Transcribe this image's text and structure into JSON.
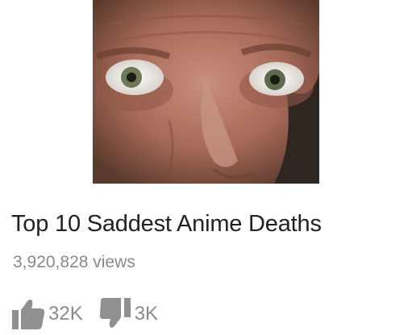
{
  "video": {
    "title": "Top 10 Saddest Anime Deaths",
    "views": "3,920,828 views"
  },
  "actions": {
    "like_count": "32K",
    "dislike_count": "3K"
  },
  "icons": {
    "like": "thumbs-up-icon",
    "dislike": "thumbs-down-icon"
  },
  "colors": {
    "title": "#222222",
    "meta": "#8a8a8a",
    "icon": "#909090"
  }
}
